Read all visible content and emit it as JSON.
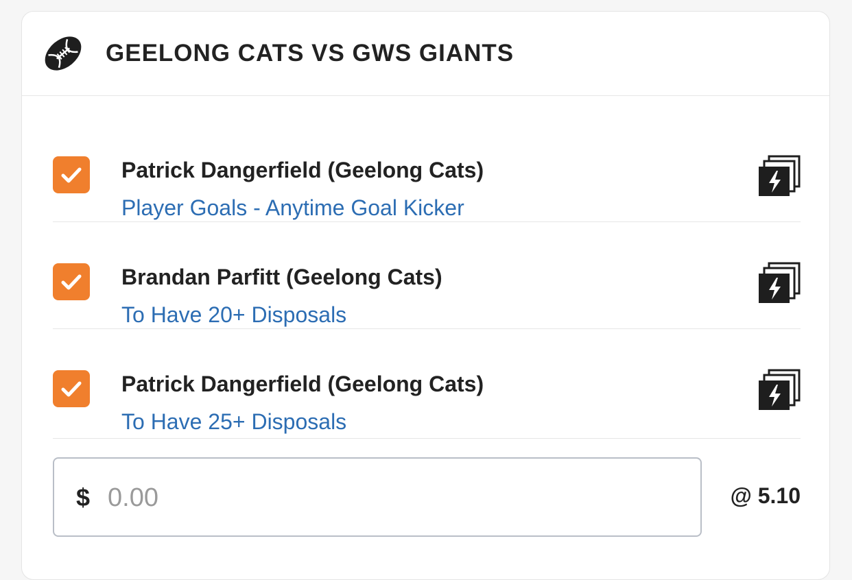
{
  "event": {
    "title": "GEELONG CATS VS GWS GIANTS",
    "icon": "football-icon"
  },
  "legs": [
    {
      "checked": true,
      "player": "Patrick Dangerfield (Geelong Cats)",
      "market": "Player Goals - Anytime Goal Kicker",
      "icon": "same-game-multi-boost-icon"
    },
    {
      "checked": true,
      "player": "Brandan Parfitt (Geelong Cats)",
      "market": "To Have 20+ Disposals",
      "icon": "same-game-multi-boost-icon"
    },
    {
      "checked": true,
      "player": "Patrick Dangerfield (Geelong Cats)",
      "market": "To Have 25+ Disposals",
      "icon": "same-game-multi-boost-icon"
    }
  ],
  "stake": {
    "currency": "$",
    "placeholder": "0.00",
    "value": ""
  },
  "odds": "@ 5.10",
  "colors": {
    "checkbox": "#f07f2d",
    "market_link": "#2c6db3",
    "text": "#222222"
  }
}
